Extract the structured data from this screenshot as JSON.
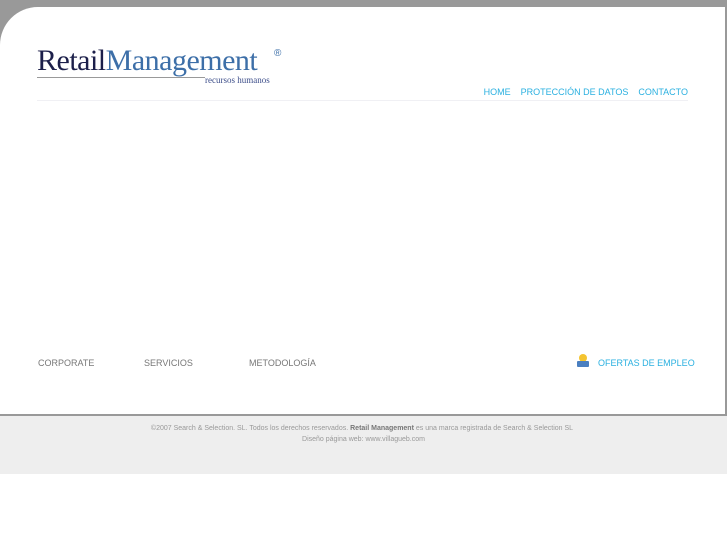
{
  "logo": {
    "part1": "Retail",
    "part2": "Management",
    "registered": "®",
    "subtitle": "recursos humanos"
  },
  "top_nav": [
    "HOME",
    "PROTECCIÓN DE DATOS",
    "CONTACTO"
  ],
  "bottom_nav": [
    "CORPORATE",
    "SERVICIOS",
    "METODOLOGÍA"
  ],
  "jobs_link": "OFERTAS DE EMPLEO",
  "footer": {
    "copyright_pre": "©2007 Search & Selection. SL. Todos los derechos reservados.",
    "brand": "Retail Management",
    "copyright_post": "es una marca registrada de Search & Selection SL",
    "design": "Diseño página web: www.villagueb.com"
  },
  "colors": {
    "link": "#2ab0e0",
    "navy": "#1c1f4a",
    "blue": "#3d6fa8"
  }
}
